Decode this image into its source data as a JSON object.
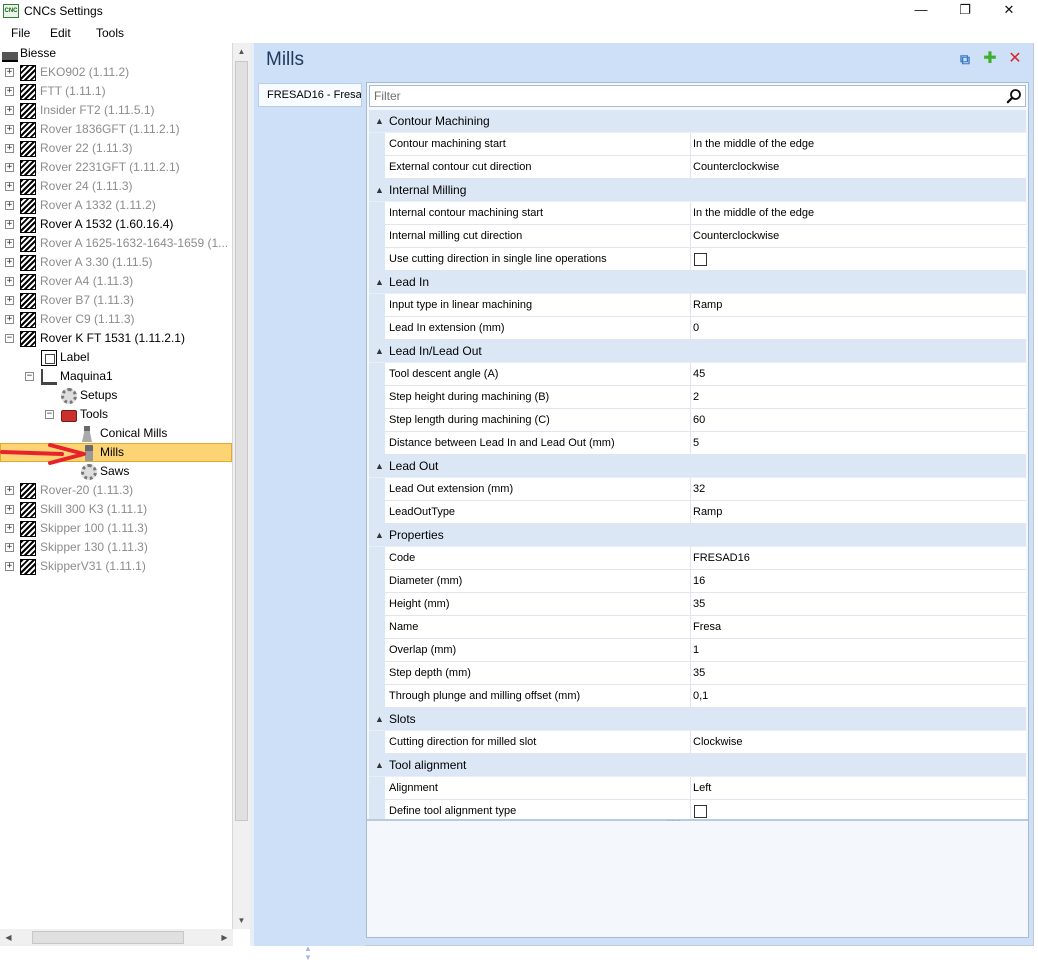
{
  "window": {
    "title": "CNCs Settings",
    "app_icon_text": "CNC",
    "minimize_glyph": "—",
    "maximize_glyph": "❐",
    "close_glyph": "✕"
  },
  "menu": [
    "File",
    "Edit",
    "Tools"
  ],
  "tree": {
    "root": "Biesse",
    "machines_before": [
      {
        "label": "EKO902 (1.11.2)",
        "active": false
      },
      {
        "label": "FTT (1.11.1)",
        "active": false
      },
      {
        "label": "Insider FT2 (1.11.5.1)",
        "active": false
      },
      {
        "label": "Rover 1836GFT (1.11.2.1)",
        "active": false
      },
      {
        "label": "Rover 22 (1.11.3)",
        "active": false
      },
      {
        "label": "Rover 2231GFT (1.11.2.1)",
        "active": false
      },
      {
        "label": "Rover 24 (1.11.3)",
        "active": false
      },
      {
        "label": "Rover A 1332 (1.11.2)",
        "active": false
      },
      {
        "label": "Rover A 1532 (1.60.16.4)",
        "active": true
      },
      {
        "label": "Rover A 1625-1632-1643-1659 (1...",
        "active": false
      },
      {
        "label": "Rover A 3.30 (1.11.5)",
        "active": false
      },
      {
        "label": "Rover A4 (1.11.3)",
        "active": false
      },
      {
        "label": "Rover B7 (1.11.3)",
        "active": false
      },
      {
        "label": "Rover C9 (1.11.3)",
        "active": false
      }
    ],
    "expanded_machine": "Rover K FT 1531 (1.11.2.1)",
    "label_node": "Label",
    "maquina": "Maquina1",
    "setups": "Setups",
    "tools": "Tools",
    "conical_mills": "Conical Mills",
    "mills": "Mills",
    "saws": "Saws",
    "machines_after": [
      {
        "label": "Rover-20 (1.11.3)",
        "active": false
      },
      {
        "label": "Skill 300 K3 (1.11.1)",
        "active": false
      },
      {
        "label": "Skipper 100 (1.11.3)",
        "active": false
      },
      {
        "label": "Skipper 130 (1.11.3)",
        "active": false
      },
      {
        "label": "SkipperV31 (1.11.1)",
        "active": false
      }
    ],
    "expand_glyph": "+",
    "collapse_glyph": "−"
  },
  "scroll_glyphs": {
    "up": "▲",
    "down": "▼",
    "left": "◀",
    "right": "▶"
  },
  "right": {
    "title": "Mills",
    "toolbar": {
      "copy_glyph": "⧉",
      "add_glyph": "✚",
      "delete_glyph": "✕"
    },
    "list_items": [
      "FRESAD16 - Fresa"
    ],
    "list_arrow_up": "▲",
    "list_arrow_down": "▼"
  },
  "grid": {
    "filter_placeholder": "Filter",
    "chevron_glyph": "▲",
    "grip_glyph": "......",
    "categories": [
      {
        "title": "Contour Machining",
        "rows": [
          {
            "name": "Contour machining start",
            "value": "In the middle of the edge"
          },
          {
            "name": "External contour cut direction",
            "value": "Counterclockwise"
          }
        ]
      },
      {
        "title": "Internal Milling",
        "rows": [
          {
            "name": "Internal contour machining start",
            "value": "In the middle of the edge"
          },
          {
            "name": "Internal milling cut direction",
            "value": "Counterclockwise"
          },
          {
            "name": "Use cutting direction in single line operations",
            "checkbox": true,
            "checked": false
          }
        ]
      },
      {
        "title": "Lead In",
        "rows": [
          {
            "name": "Input type in linear machining",
            "value": "Ramp"
          },
          {
            "name": "Lead In extension (mm)",
            "value": "0"
          }
        ]
      },
      {
        "title": "Lead In/Lead Out",
        "rows": [
          {
            "name": "Tool descent angle (A)",
            "value": "45"
          },
          {
            "name": "Step height during machining (B)",
            "value": "2"
          },
          {
            "name": "Step length during machining (C)",
            "value": "60"
          },
          {
            "name": "Distance between Lead In and Lead Out (mm)",
            "value": "5"
          }
        ]
      },
      {
        "title": "Lead Out",
        "rows": [
          {
            "name": "Lead Out extension (mm)",
            "value": "32"
          },
          {
            "name": "LeadOutType",
            "value": "Ramp"
          }
        ]
      },
      {
        "title": "Properties",
        "rows": [
          {
            "name": "Code",
            "value": "FRESAD16"
          },
          {
            "name": "Diameter (mm)",
            "value": "16"
          },
          {
            "name": "Height (mm)",
            "value": "35"
          },
          {
            "name": "Name",
            "value": "Fresa"
          },
          {
            "name": "Overlap (mm)",
            "value": "1"
          },
          {
            "name": "Step depth (mm)",
            "value": "35"
          },
          {
            "name": "Through plunge and milling offset (mm)",
            "value": "0,1"
          }
        ]
      },
      {
        "title": "Slots",
        "rows": [
          {
            "name": "Cutting direction for milled slot",
            "value": "Clockwise"
          }
        ]
      },
      {
        "title": "Tool alignment",
        "rows": [
          {
            "name": "Alignment",
            "value": "Left"
          },
          {
            "name": "Define tool alignment type",
            "checkbox": true,
            "checked": false
          }
        ]
      }
    ]
  },
  "colors": {
    "selection_fill": "#fcd476",
    "panel_blue": "#cde0f7",
    "category_bg": "#dce7f5",
    "grey_text": "#8c8c8c",
    "arrow_red": "#e8212b"
  }
}
